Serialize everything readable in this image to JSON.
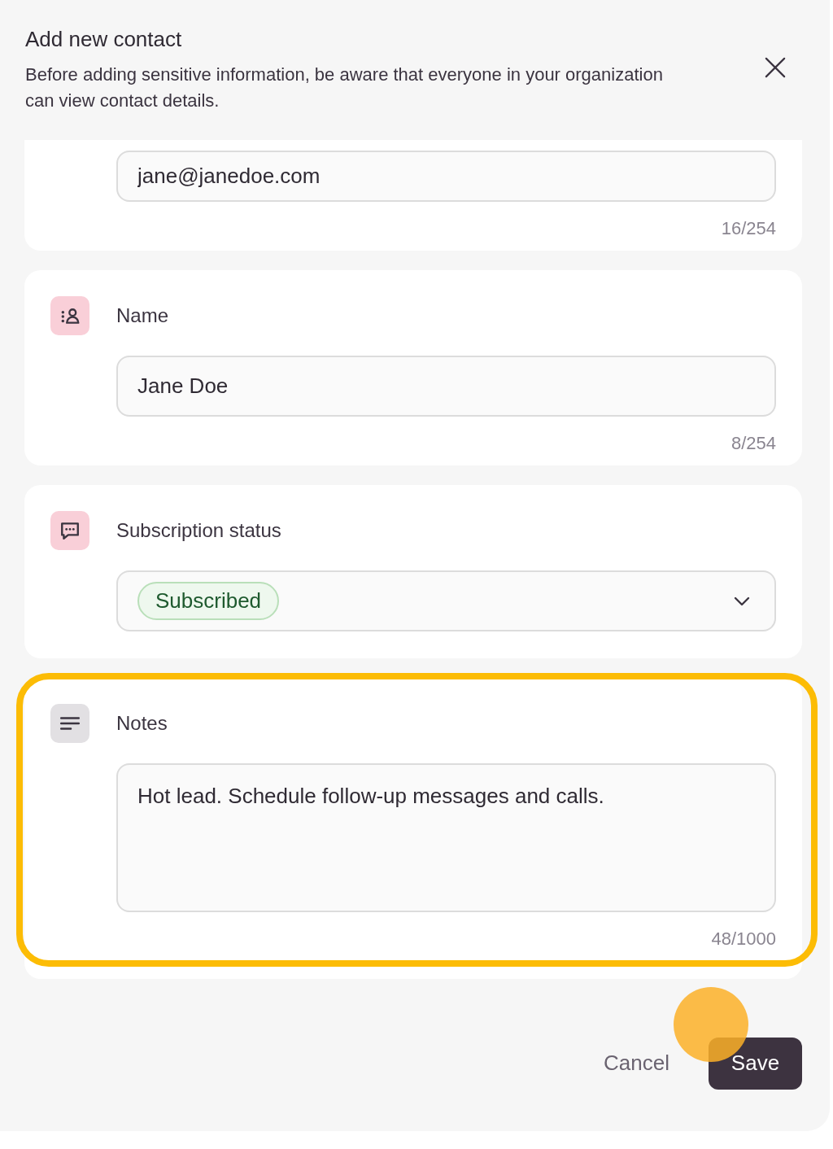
{
  "dialog": {
    "title": "Add new contact",
    "description": "Before adding sensitive information, be aware that everyone in your organization can view contact details."
  },
  "fields": [
    {
      "kind": "text",
      "value": "jane@janedoe.com",
      "counter": "16/254",
      "highlighted": false
    },
    {
      "kind": "text",
      "label": "Name",
      "color": "#f9cfd8",
      "value": "Jane Doe",
      "counter": "8/254",
      "highlighted": false
    },
    {
      "kind": "select",
      "label": "Subscription status",
      "color": "#f9cfd8",
      "value": "Subscribed",
      "highlighted": false
    },
    {
      "kind": "textarea",
      "label": "Notes",
      "color": "#e2e0e3",
      "value": "Hot lead. Schedule follow-up messages and calls.",
      "counter": "48/1000",
      "highlighted": true
    }
  ],
  "actions": {
    "cancel": "Cancel",
    "save": "Save",
    "touch_marker": true
  }
}
